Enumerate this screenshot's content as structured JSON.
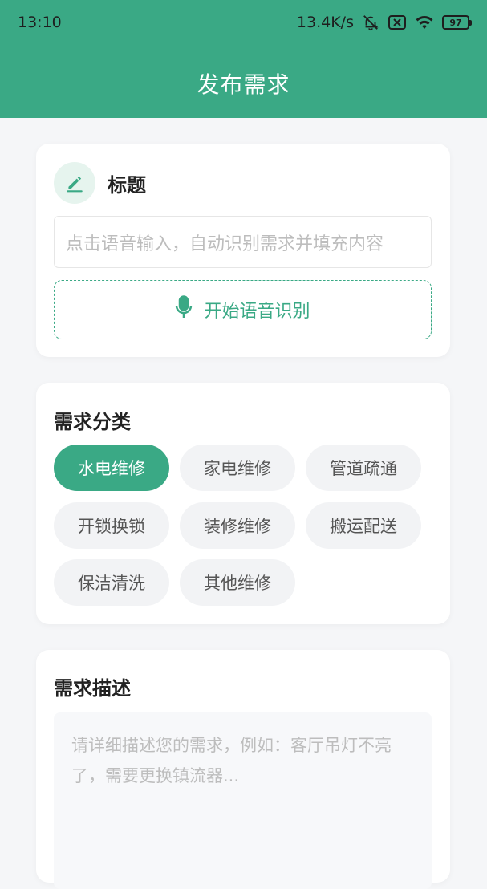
{
  "status_bar": {
    "time": "13:10",
    "network_speed": "13.4K/s",
    "battery": "97",
    "icons": [
      "bell-muted-icon",
      "sim-off-icon",
      "wifi-icon",
      "battery-icon"
    ]
  },
  "header": {
    "title": "发布需求"
  },
  "title_card": {
    "label": "标题",
    "icon": "pencil-icon",
    "input_placeholder": "点击语音输入，自动识别需求并填充内容",
    "voice_button_label": "开始语音识别",
    "voice_icon": "microphone-icon"
  },
  "category_card": {
    "title": "需求分类",
    "selected": "水电维修",
    "chips": [
      {
        "label": "水电维修",
        "active": true
      },
      {
        "label": "家电维修",
        "active": false
      },
      {
        "label": "管道疏通",
        "active": false
      },
      {
        "label": "开锁换锁",
        "active": false
      },
      {
        "label": "装修维修",
        "active": false
      },
      {
        "label": "搬运配送",
        "active": false
      },
      {
        "label": "保洁清洗",
        "active": false
      },
      {
        "label": "其他维修",
        "active": false
      }
    ]
  },
  "description_card": {
    "title": "需求描述",
    "placeholder": "请详细描述您的需求，例如：客厅吊灯不亮了，需要更换镇流器..."
  },
  "colors": {
    "primary": "#3aa985",
    "background": "#f5f6f8",
    "chip_bg": "#f2f3f5",
    "placeholder": "#bdbdbd"
  }
}
